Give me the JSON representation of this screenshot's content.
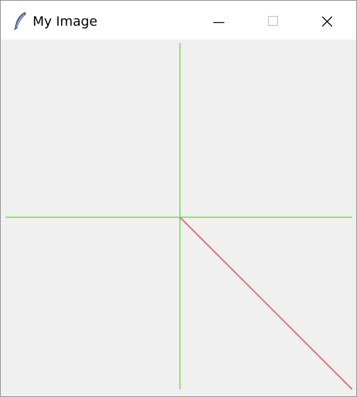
{
  "window": {
    "title": "My Image",
    "app_icon": "feather-icon"
  },
  "titlebar": {
    "minimize_icon": "minimize-icon",
    "maximize_icon": "maximize-icon",
    "close_icon": "close-icon"
  },
  "canvas": {
    "background": "#f0f0f0",
    "axis_color": "#7fe86a",
    "line_color": "#e07070"
  }
}
